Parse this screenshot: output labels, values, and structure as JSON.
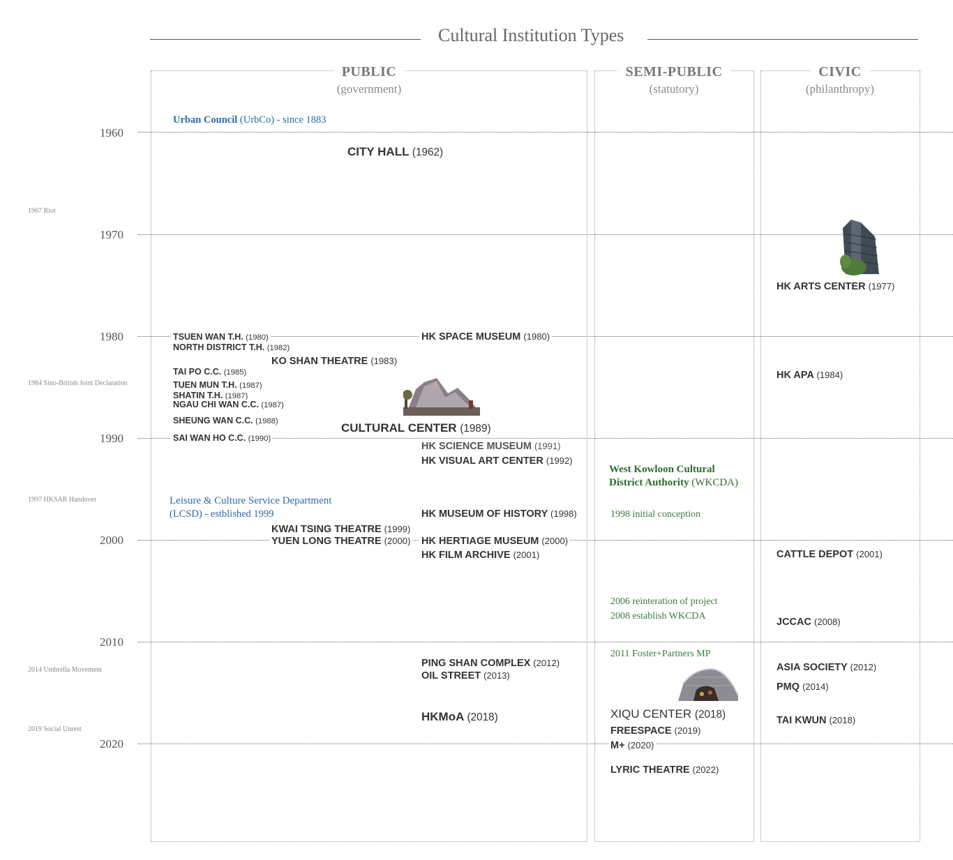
{
  "title": "Cultural Institution Types",
  "columns": [
    {
      "heading": "PUBLIC",
      "sub": "(government)"
    },
    {
      "heading": "SEMI-PUBLIC",
      "sub": "(statutory)"
    },
    {
      "heading": "CIVIC",
      "sub": "(philanthropy)"
    }
  ],
  "years": [
    "1960",
    "1970",
    "1980",
    "1990",
    "2000",
    "2010",
    "2020"
  ],
  "events": [
    "1967 Riot",
    "1984 Sino-British Joint Declaration",
    "1997 HKSAR Handover",
    "2014 Umbrella Movement",
    "2019 Social Unrest"
  ],
  "authorities": {
    "urbco_name": "Urban Council",
    "urbco_rest": " (UrbCo) - since 1883",
    "lcsd_name": "Leisure & Culture Service Department",
    "lcsd_rest": "(LCSD) - estblished 1999"
  },
  "public": [
    {
      "name": "CITY HALL",
      "year": "(1962)"
    },
    {
      "name": "TSUEN WAN T.H.",
      "year": "(1980)"
    },
    {
      "name": "NORTH DISTRICT T.H.",
      "year": "(1982)"
    },
    {
      "name": "KO SHAN THEATRE",
      "year": "(1983)"
    },
    {
      "name": "TAI PO C.C.",
      "year": "(1985)"
    },
    {
      "name": "TUEN MUN T.H.",
      "year": "(1987)"
    },
    {
      "name": "SHATIN T.H.",
      "year": "(1987)"
    },
    {
      "name": "NGAU CHI WAN C.C.",
      "year": "(1987)"
    },
    {
      "name": "SHEUNG WAN C.C.",
      "year": "(1988)"
    },
    {
      "name": "CULTURAL CENTER",
      "year": "(1989)"
    },
    {
      "name": "SAI WAN HO C.C.",
      "year": "(1990)"
    },
    {
      "name": "HK SPACE MUSEUM",
      "year": "(1980)"
    },
    {
      "name": "HK SCIENCE MUSEUM",
      "year": "(1991)"
    },
    {
      "name": "HK VISUAL ART CENTER",
      "year": "(1992)"
    },
    {
      "name": "HK MUSEUM OF HISTORY",
      "year": "(1998)"
    },
    {
      "name": "KWAI TSING THEATRE",
      "year": "(1999)"
    },
    {
      "name": "YUEN LONG THEATRE",
      "year": "(2000)"
    },
    {
      "name": "HK HERTIAGE MUSEUM",
      "year": "(2000)"
    },
    {
      "name": "HK FILM ARCHIVE",
      "year": "(2001)"
    },
    {
      "name": "PING SHAN COMPLEX",
      "year": "(2012)"
    },
    {
      "name": "OIL STREET",
      "year": "(2013)"
    },
    {
      "name": "HKMoA",
      "year": "(2018)"
    }
  ],
  "semi_public": {
    "wkcda_line1": "West Kowloon Cultural",
    "wkcda_line2": "District Authority",
    "wkcda_abbr": " (WKCDA)",
    "notes": [
      "1998 initial conception",
      "2006 reinteration of project",
      "2008 establish WKCDA",
      "2011 Foster+Partners MP"
    ],
    "institutions": [
      {
        "name": "XIQU CENTER",
        "year": "(2018)"
      },
      {
        "name": "FREESPACE",
        "year": "(2019)"
      },
      {
        "name": "M+",
        "year": "(2020)"
      },
      {
        "name": "LYRIC THEATRE",
        "year": "(2022)"
      }
    ]
  },
  "civic": [
    {
      "name": "HK ARTS CENTER",
      "year": "(1977)"
    },
    {
      "name": "HK APA",
      "year": "(1984)"
    },
    {
      "name": "CATTLE DEPOT",
      "year": "(2001)"
    },
    {
      "name": "JCCAC",
      "year": "(2008)"
    },
    {
      "name": "ASIA SOCIETY",
      "year": "(2012)"
    },
    {
      "name": "PMQ",
      "year": "(2014)"
    },
    {
      "name": "TAI KWUN",
      "year": "(2018)"
    }
  ]
}
